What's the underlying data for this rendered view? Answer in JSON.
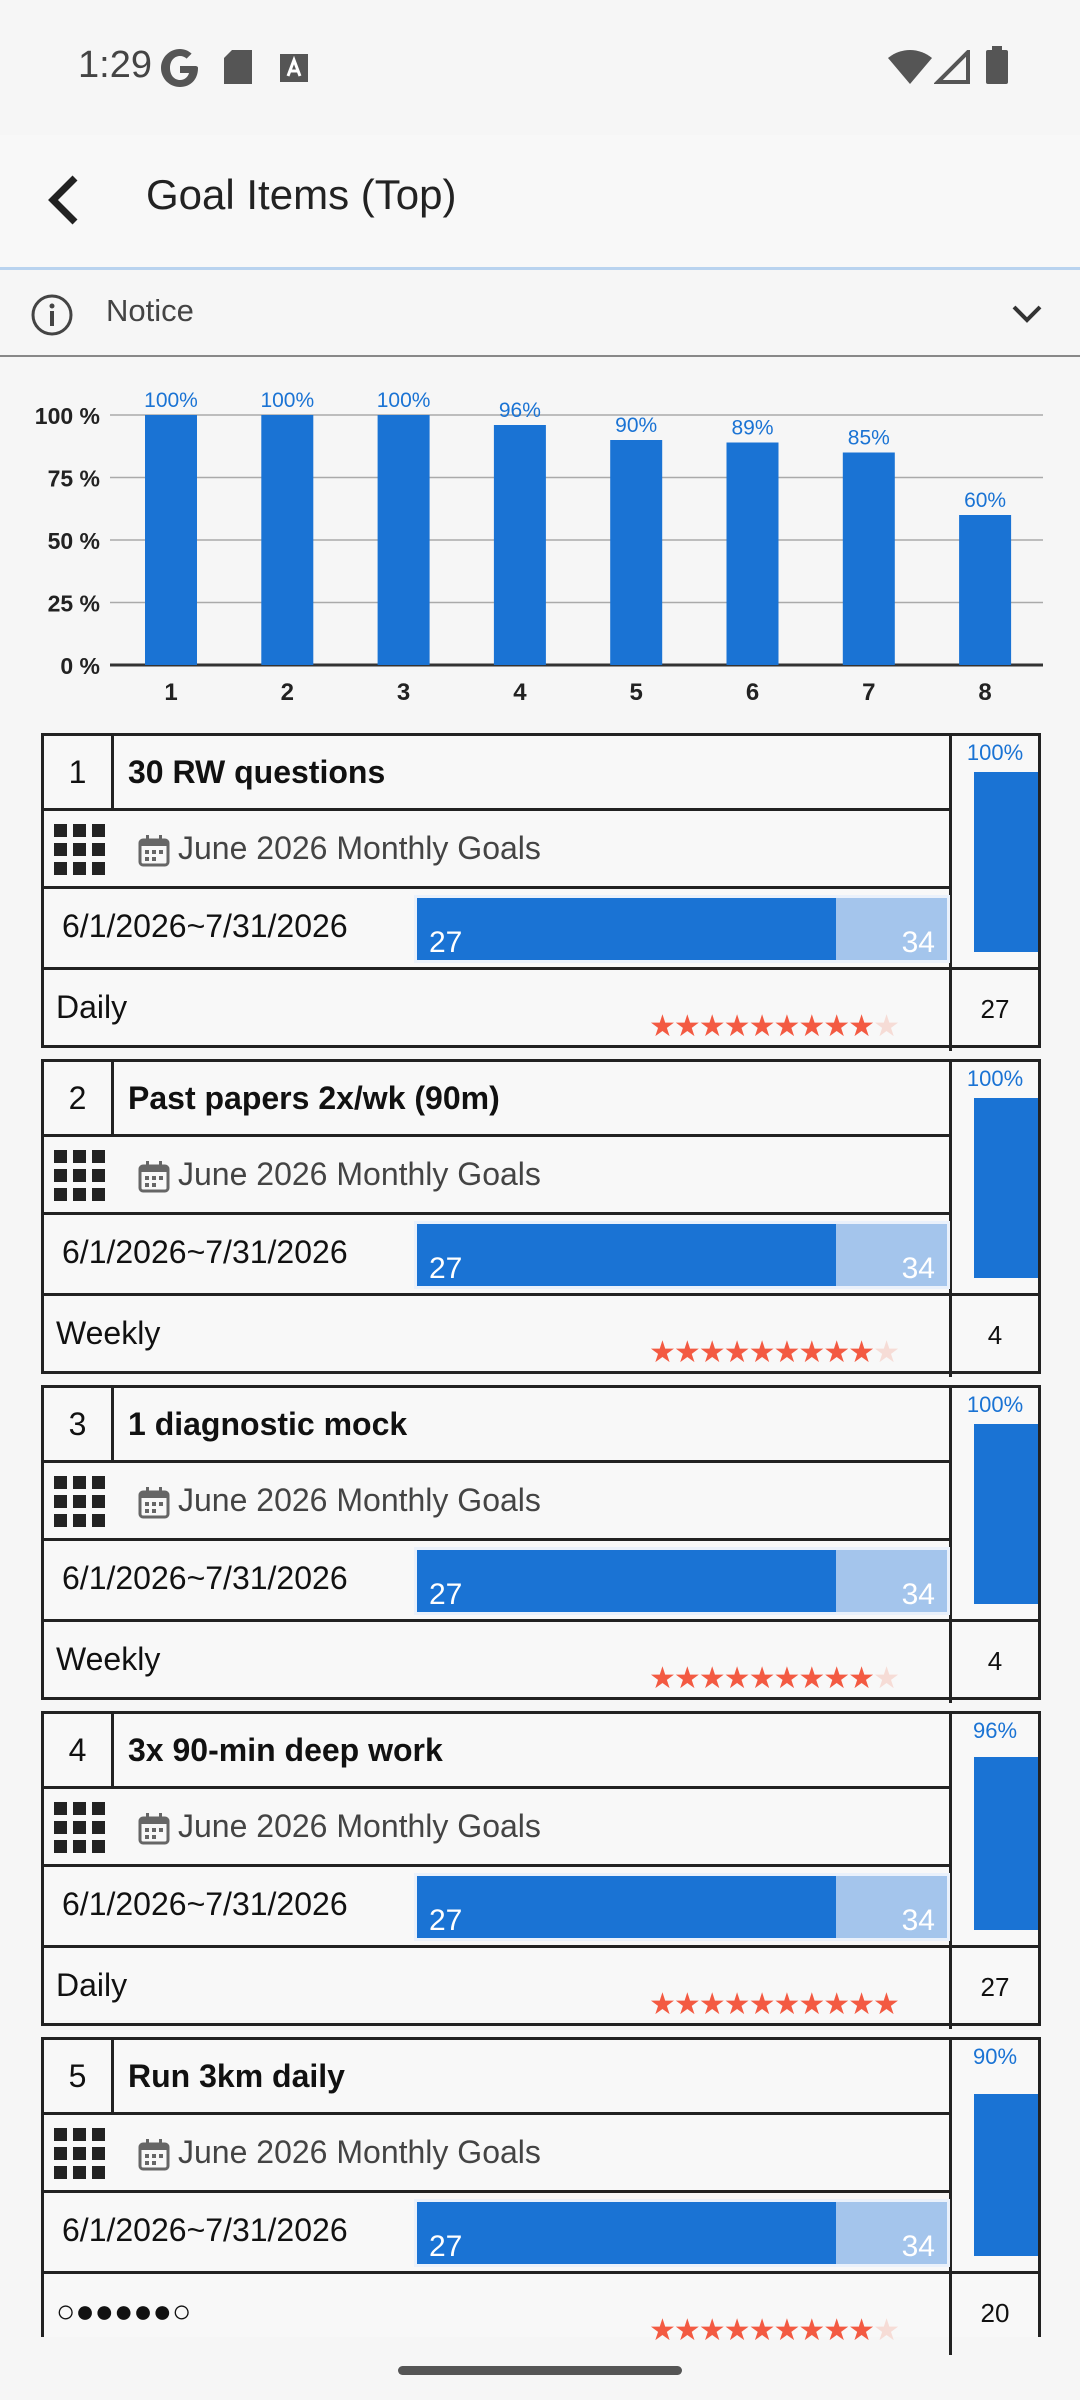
{
  "status": {
    "time": "1:29",
    "icons": [
      "google-icon",
      "sd-card-icon",
      "text-icon",
      "wifi-icon",
      "signal-icon",
      "battery-icon"
    ]
  },
  "app_bar": {
    "title": "Goal Items (Top)"
  },
  "notice": {
    "label": "Notice"
  },
  "chart_data": {
    "type": "bar",
    "categories": [
      "1",
      "2",
      "3",
      "4",
      "5",
      "6",
      "7",
      "8"
    ],
    "values": [
      100,
      100,
      100,
      96,
      90,
      89,
      85,
      60
    ],
    "value_labels": [
      "100%",
      "100%",
      "100%",
      "96%",
      "90%",
      "89%",
      "85%",
      "60%"
    ],
    "yticks": [
      "0 %",
      "25 %",
      "50 %",
      "75 %",
      "100 %"
    ],
    "ylim": [
      0,
      100
    ],
    "grid": true,
    "color": "#1a73d4"
  },
  "cards": [
    {
      "num": "1",
      "title": "30 RW questions",
      "group": "June 2026 Monthly Goals",
      "range": "6/1/2026~7/31/2026",
      "prog_start": "27",
      "prog_end": "34",
      "progress": 0.79,
      "freq": "Daily",
      "stars_on": 9,
      "stars_total": 10,
      "pct": "100%",
      "pct_value": 100,
      "count": "27"
    },
    {
      "num": "2",
      "title": "Past papers 2x/wk (90m)",
      "group": "June 2026 Monthly Goals",
      "range": "6/1/2026~7/31/2026",
      "prog_start": "27",
      "prog_end": "34",
      "progress": 0.79,
      "freq": "Weekly",
      "stars_on": 9,
      "stars_total": 10,
      "pct": "100%",
      "pct_value": 100,
      "count": "4"
    },
    {
      "num": "3",
      "title": "1 diagnostic mock",
      "group": "June 2026 Monthly Goals",
      "range": "6/1/2026~7/31/2026",
      "prog_start": "27",
      "prog_end": "34",
      "progress": 0.79,
      "freq": "Weekly",
      "stars_on": 9,
      "stars_total": 10,
      "pct": "100%",
      "pct_value": 100,
      "count": "4"
    },
    {
      "num": "4",
      "title": "3x 90-min deep work",
      "group": "June 2026 Monthly Goals",
      "range": "6/1/2026~7/31/2026",
      "prog_start": "27",
      "prog_end": "34",
      "progress": 0.79,
      "freq": "Daily",
      "stars_on": 10,
      "stars_total": 10,
      "pct": "96%",
      "pct_value": 96,
      "count": "27"
    },
    {
      "num": "5",
      "title": "Run 3km daily",
      "group": "June 2026 Monthly Goals",
      "range": "6/1/2026~7/31/2026",
      "prog_start": "27",
      "prog_end": "34",
      "progress": 0.79,
      "freq": "○●●●●●○",
      "stars_on": 9,
      "stars_total": 10,
      "pct": "90%",
      "pct_value": 90,
      "count": "20"
    }
  ]
}
